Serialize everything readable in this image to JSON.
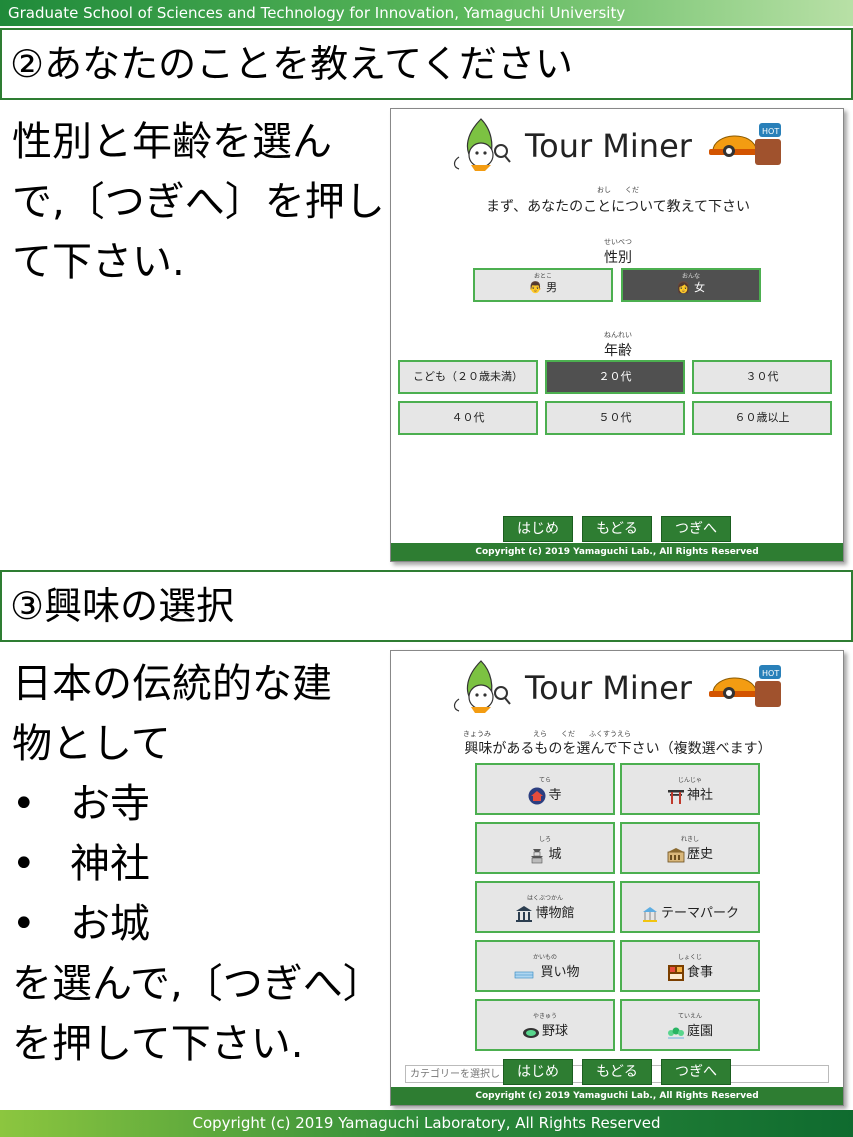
{
  "header": {
    "org": "Graduate School of Sciences and Technology for Innovation, Yamaguchi University"
  },
  "step2": {
    "title": "②あなたのことを教えてください",
    "instruction_lines": [
      "性別と年齢を選ん",
      "で,〔つぎへ〕を押し",
      "て下さい."
    ]
  },
  "step3": {
    "title": "③興味の選択",
    "instruction_lines": [
      "日本の伝統的な建",
      "物として"
    ],
    "bullets": [
      "お寺",
      "神社",
      "お城"
    ],
    "instruction_tail": [
      "を選んで,〔つぎへ〕",
      "を押して下さい."
    ]
  },
  "app": {
    "brand": "Tour Miner",
    "helmet_tag": "HOT",
    "footer": "Copyright (c) 2019 Yamaguchi Lab., All Rights Reserved",
    "nav": {
      "start": "はじめ",
      "back": "もどる",
      "next": "つぎへ"
    }
  },
  "screen1": {
    "prompt_ruby": "おし　　くだ",
    "prompt": "まず、あなたのことについて教えて下さい",
    "gender_ruby": "せいべつ",
    "gender_label": "性別",
    "gender_options": [
      {
        "ruby": "おとこ",
        "label": "男",
        "icon": "man-icon",
        "selected": false
      },
      {
        "ruby": "おんな",
        "label": "女",
        "icon": "woman-icon",
        "selected": true
      }
    ],
    "age_ruby": "ねんれい",
    "age_label": "年齢",
    "age_options": [
      {
        "label": "こども（２０歳未満）",
        "selected": false
      },
      {
        "label": "２０代",
        "selected": true
      },
      {
        "label": "３０代",
        "selected": false
      },
      {
        "label": "４０代",
        "selected": false
      },
      {
        "label": "５０代",
        "selected": false
      },
      {
        "label": "６０歳以上",
        "selected": false
      }
    ]
  },
  "screen2": {
    "prompt_ruby": "きょうみ　　　　　　えら　　くだ　　ふくすうえら",
    "prompt": "興味があるものを選んで下さい（複数選べます）",
    "interests": [
      {
        "ruby": "てら",
        "label": "寺",
        "icon": "temple-icon"
      },
      {
        "ruby": "じんじゃ",
        "label": "神社",
        "icon": "torii-icon"
      },
      {
        "ruby": "しろ",
        "label": "城",
        "icon": "castle-icon"
      },
      {
        "ruby": "れきし",
        "label": "歴史",
        "icon": "history-icon"
      },
      {
        "ruby": "はくぶつかん",
        "label": "博物館",
        "icon": "museum-icon"
      },
      {
        "ruby": "",
        "label": "テーマパーク",
        "icon": "carousel-icon"
      },
      {
        "ruby": "かいもの",
        "label": "買い物",
        "icon": "shopping-icon"
      },
      {
        "ruby": "しょくじ",
        "label": "食事",
        "icon": "meal-icon"
      },
      {
        "ruby": "やきゅう",
        "label": "野球",
        "icon": "stadium-icon"
      },
      {
        "ruby": "ていえん",
        "label": "庭園",
        "icon": "garden-icon"
      }
    ],
    "category_placeholder": "カテゴリーを選択し"
  },
  "footer": {
    "copyright": "Copyright (c) 2019 Yamaguchi  Laboratory, All Rights Reserved"
  },
  "colors": {
    "accent_green": "#2e7d32",
    "button_border": "#4caf50",
    "selected_bg": "#505050"
  }
}
